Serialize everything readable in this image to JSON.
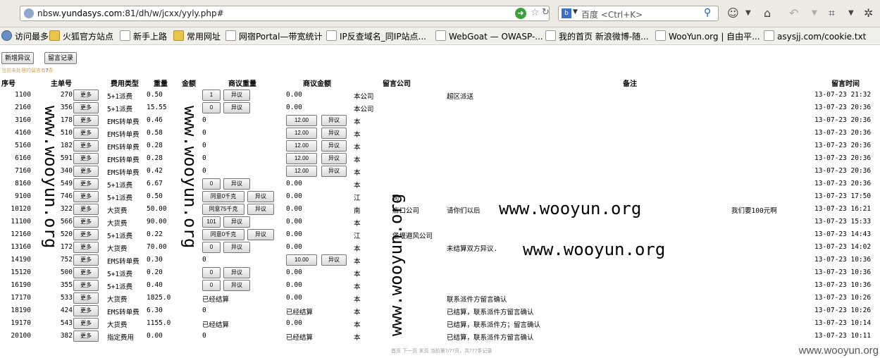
{
  "browser": {
    "url_prefix": "nbsw.",
    "url_host": "yundasys.com",
    "url_rest": ":81/dh/w/jcxx/yyly.php#",
    "search_engine": "百度",
    "search_placeholder": "百度 <Ctrl+K>",
    "bookmarks": [
      "访问最多",
      "火狐官方站点",
      "新手上路",
      "常用网址",
      "网宿Portal—带宽统计",
      "IP反查域名_同IP站点...",
      "WebGoat — OWASP-...",
      "我的首页 新浪微博-随...",
      "WooYun.org | 自由平...",
      "asysjj.com/cookie.txt"
    ]
  },
  "page": {
    "btn_new": "新增异议",
    "btn_log": "留言记录",
    "notice_pre": "当前未处理的留言有",
    "notice_count": "?",
    "notice_post": "条",
    "headers": [
      "序号",
      "主单号",
      "费用类型",
      "重量",
      "金额",
      "商议重量",
      "商议金额",
      "留言公司",
      "备注",
      "留言时间"
    ],
    "more": "更多",
    "object": "异议",
    "rows": [
      {
        "no": "1100",
        "bill": "270",
        "type": "5+1派费",
        "weight": "0.50",
        "w_btn": "1",
        "w_obj": true,
        "amount": "0.00",
        "a_btn": "",
        "company": "本公司",
        "remark": "超区派送",
        "time": "13-07-23 21:32"
      },
      {
        "no": "2160",
        "bill": "356",
        "type": "5+1派费",
        "weight": "15.55",
        "w_btn": "0",
        "w_obj": true,
        "amount": "0.00",
        "a_btn": "",
        "company": "本公司",
        "remark": "",
        "time": "13-07-23 20:36"
      },
      {
        "no": "3160",
        "bill": "178",
        "type": "EMS转单费",
        "weight": "0.46",
        "w_btn": "",
        "w_obj": false,
        "amount": "0",
        "a_btn": "12.00",
        "company": "本",
        "remark": "",
        "time": "13-07-23 20:36"
      },
      {
        "no": "4160",
        "bill": "510",
        "type": "EMS转单费",
        "weight": "0.58",
        "w_btn": "",
        "w_obj": false,
        "amount": "0",
        "a_btn": "12.00",
        "company": "本",
        "remark": "",
        "time": "13-07-23 20:36"
      },
      {
        "no": "5160",
        "bill": "182",
        "type": "EMS转单费",
        "weight": "0.28",
        "w_btn": "",
        "w_obj": false,
        "amount": "0",
        "a_btn": "12.00",
        "company": "本",
        "remark": "",
        "time": "13-07-23 20:36"
      },
      {
        "no": "6160",
        "bill": "591",
        "type": "EMS转单费",
        "weight": "0.28",
        "w_btn": "",
        "w_obj": false,
        "amount": "0",
        "a_btn": "12.00",
        "company": "本",
        "remark": "",
        "time": "13-07-23 20:36"
      },
      {
        "no": "7160",
        "bill": "340",
        "type": "EMS转单费",
        "weight": "0.42",
        "w_btn": "",
        "w_obj": false,
        "amount": "0",
        "a_btn": "12.00",
        "company": "本",
        "remark": "",
        "time": "13-07-23 20:36"
      },
      {
        "no": "8160",
        "bill": "549",
        "type": "5+1派费",
        "weight": "6.67",
        "w_btn": "0",
        "w_obj": true,
        "amount": "0.00",
        "a_btn": "",
        "company": "本",
        "remark": "",
        "time": "13-07-23 20:36"
      },
      {
        "no": "9100",
        "bill": "746",
        "type": "5+1派费",
        "weight": "0.50",
        "w_btn": "同意0千克",
        "w_obj": true,
        "amount": "0.00",
        "a_btn": "",
        "company": "江",
        "company2": "司",
        "remark": "",
        "time": "13-07-23 17:50"
      },
      {
        "no": "10120",
        "bill": "322",
        "type": "大货费",
        "weight": "50.00",
        "w_btn": "同意75千克",
        "w_obj": true,
        "amount": "0.00",
        "a_btn": "",
        "company": "南",
        "company2": "店口公司",
        "remark": "请你们以后",
        "remark2": "我们要100元啊",
        "time": "13-07-23 16:21"
      },
      {
        "no": "11100",
        "bill": "566",
        "type": "大货费",
        "weight": "90.00",
        "w_btn": "101",
        "w_obj": true,
        "amount": "0.00",
        "a_btn": "",
        "company": "本",
        "remark": "",
        "time": "13-07-23 15:33"
      },
      {
        "no": "12160",
        "bill": "520",
        "type": "5+1派费",
        "weight": "0.22",
        "w_btn": "同意0千克",
        "w_obj": true,
        "amount": "0.00",
        "a_btn": "",
        "company": "江",
        "company2": "堡堰避风公司",
        "remark": "",
        "time": "13-07-23 14:43"
      },
      {
        "no": "13160",
        "bill": "172",
        "type": "大货费",
        "weight": "70.00",
        "w_btn": "0",
        "w_obj": true,
        "amount": "0.00",
        "a_btn": "",
        "company": "本",
        "remark": "未结算双方异议.",
        "time": "13-07-23 14:02"
      },
      {
        "no": "14190",
        "bill": "752",
        "type": "EMS转单费",
        "weight": "0.30",
        "w_btn": "",
        "w_obj": false,
        "amount": "0",
        "a_btn": "10.00",
        "company": "本",
        "remark": "",
        "time": "13-07-23 10:36"
      },
      {
        "no": "15120",
        "bill": "500",
        "type": "5+1派费",
        "weight": "0.20",
        "w_btn": "0",
        "w_obj": true,
        "amount": "0.00",
        "a_btn": "",
        "company": "本",
        "remark": "",
        "time": "13-07-23 10:36"
      },
      {
        "no": "16190",
        "bill": "355",
        "type": "5+1派费",
        "weight": "0.40",
        "w_btn": "0",
        "w_obj": true,
        "amount": "0.00",
        "a_btn": "",
        "company": "本",
        "remark": "",
        "time": "13-07-23 10:36"
      },
      {
        "no": "17170",
        "bill": "533",
        "type": "大货费",
        "weight": "1825.0",
        "w_btn": "",
        "w_obj": false,
        "w_text": "已经结算",
        "amount": "0.00",
        "a_btn": "",
        "company": "本",
        "remark": "联系派件方留言确认",
        "time": "13-07-23 10:26"
      },
      {
        "no": "18190",
        "bill": "424",
        "type": "EMS转单费",
        "weight": "6.30",
        "w_btn": "",
        "w_obj": false,
        "amount": "0",
        "a_btn": "",
        "a_text": "已经结算",
        "company": "本",
        "remark": "已结算，联系派件方留言确认",
        "time": "13-07-23 10:26"
      },
      {
        "no": "19170",
        "bill": "543",
        "type": "大货费",
        "weight": "1155.0",
        "w_btn": "",
        "w_obj": false,
        "w_text": "已经结算",
        "amount": "0.00",
        "a_btn": "",
        "company": "本",
        "remark": "已结算，联系派件方；留言确认",
        "time": "13-07-23 10:14"
      },
      {
        "no": "20100",
        "bill": "382",
        "type": "指定费用",
        "weight": "0.00",
        "w_btn": "",
        "w_obj": false,
        "amount": "0",
        "a_btn": "",
        "a_text": "已经结算",
        "company": "本",
        "remark": "已结算，联系派件方留言确认",
        "time": "13-07-23 10:11"
      }
    ],
    "pager": "首页 下一页 末页 当前第?/??页，共???条记录",
    "watermark": "www.wooyun.org",
    "corner_watermark": "www.wooyun.org"
  }
}
